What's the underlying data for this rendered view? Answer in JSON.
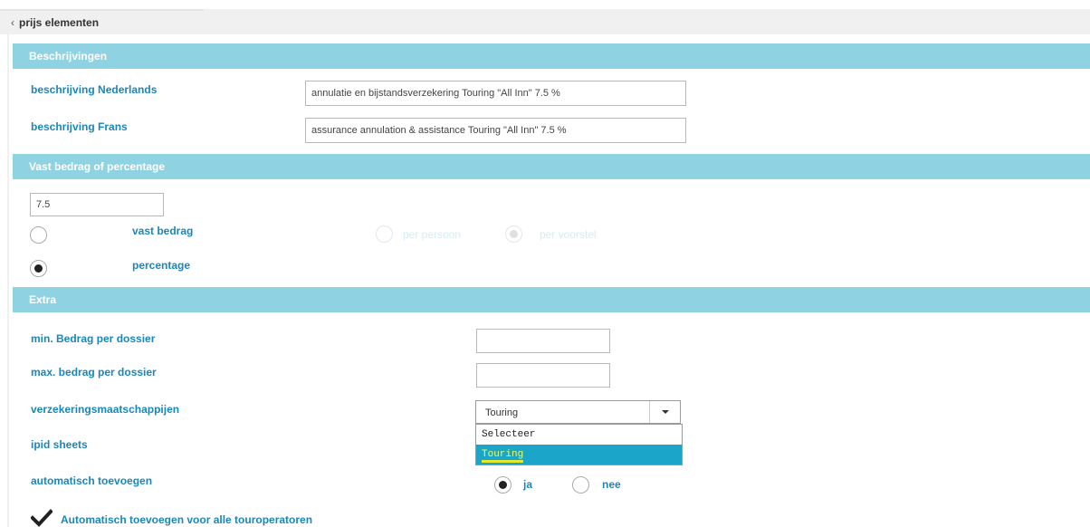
{
  "nav": {
    "back_label": "prijs elementen"
  },
  "sections": {
    "descriptions": "Beschrijvingen",
    "amount": "Vast bedrag of percentage",
    "extra": "Extra"
  },
  "descriptions": {
    "nl_label": "beschrijving Nederlands",
    "nl_value": "annulatie en bijstandsverzekering Touring \"All Inn\" 7.5 %",
    "fr_label": "beschrijving Frans",
    "fr_value": "assurance annulation & assistance Touring \"All Inn\" 7.5 %"
  },
  "amount": {
    "value": "7.5",
    "fixed_label": "vast bedrag",
    "percentage_label": "percentage",
    "selected": "percentage",
    "per_person_label": "per persoon",
    "per_proposal_label": "per voorstel"
  },
  "extra": {
    "min_label": "min. Bedrag per dossier",
    "min_value": "",
    "max_label": "max. bedrag per dossier",
    "max_value": "",
    "insurers_label": "verzekeringsmaatschappijen",
    "insurers_value": "Touring",
    "insurers_options": [
      "Selecteer",
      "Touring"
    ],
    "insurers_highlighted": "Touring",
    "ipid_label": "ipid sheets",
    "auto_add_label": "automatisch toevoegen",
    "auto_add_yes": "ja",
    "auto_add_no": "nee",
    "auto_add_selected": "ja",
    "all_operators_label": "Automatisch toevoegen voor alle touroperatoren",
    "all_operators_checked": true
  },
  "colors": {
    "section_bar": "#8fd2e2",
    "label": "#1a87b8",
    "dropdown_highlight": "#1ba6c9"
  }
}
